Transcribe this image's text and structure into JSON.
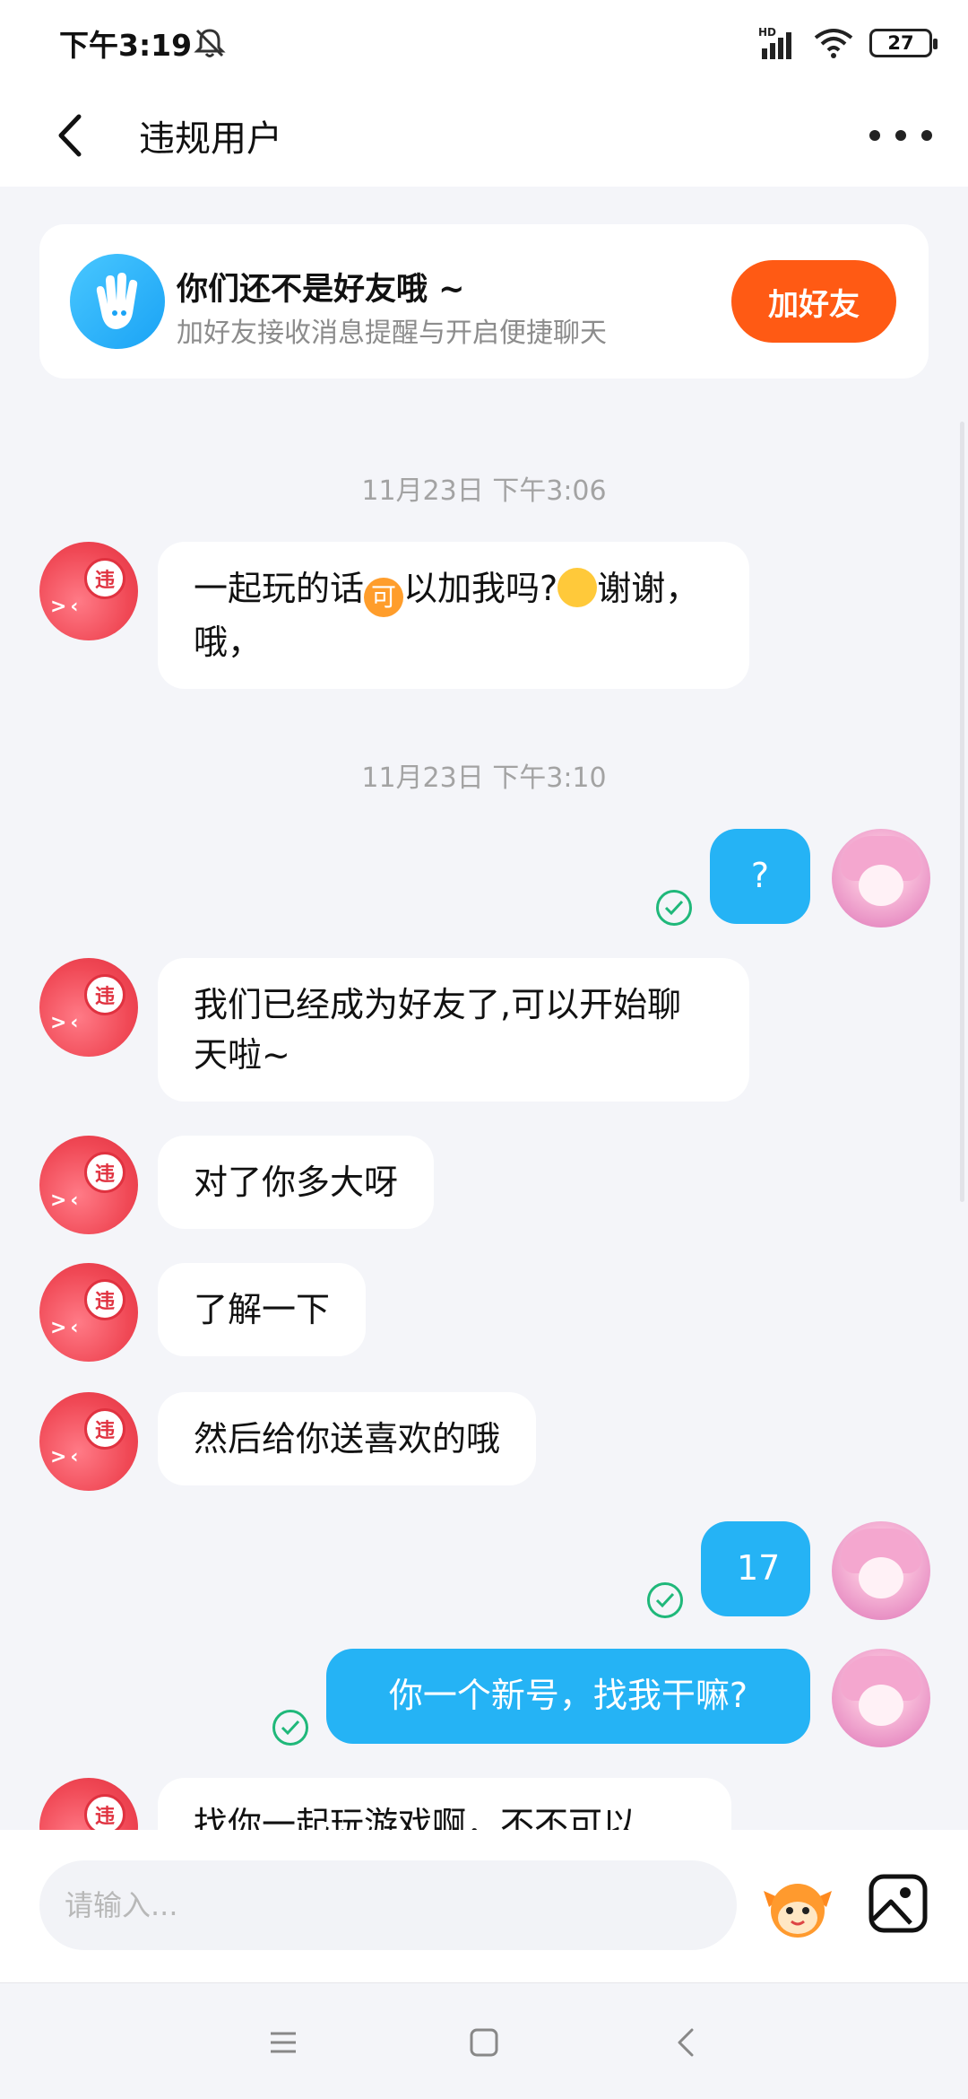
{
  "status_bar": {
    "time": "下午3:19",
    "network": "HD",
    "battery": "27"
  },
  "header": {
    "title": "违规用户",
    "back_icon": "chevron-left-icon",
    "more_icon": "more-horizontal-icon"
  },
  "friend_card": {
    "title": "你们还不是好友哦 ~",
    "subtitle": "加好友接收消息提醒与开启便捷聊天",
    "button": "加好友",
    "icon": "hand-wave-icon"
  },
  "avatar_badge": "违",
  "messages": {
    "ts1": "11月23日 下午3:06",
    "m1_a": "一起玩的话",
    "m1_emoji1": "可",
    "m1_b": "以加我吗?",
    "m1_c": "谢谢，哦，",
    "ts2": "11月23日 下午3:10",
    "m2": "?",
    "m3": "我们已经成为好友了,可以开始聊天啦~",
    "m4": "对了你多大呀",
    "m5": "了解一下",
    "m6": "然后给你送喜欢的哦",
    "m7": "17",
    "m8": "你一个新号，找我干嘛?",
    "m9": "找你一起玩游戏啊，不不可以"
  },
  "input": {
    "placeholder": "请输入..."
  },
  "colors": {
    "accent_orange": "#ff5a14",
    "bubble_blue": "#25b3f5",
    "check_green": "#1fb87a"
  }
}
